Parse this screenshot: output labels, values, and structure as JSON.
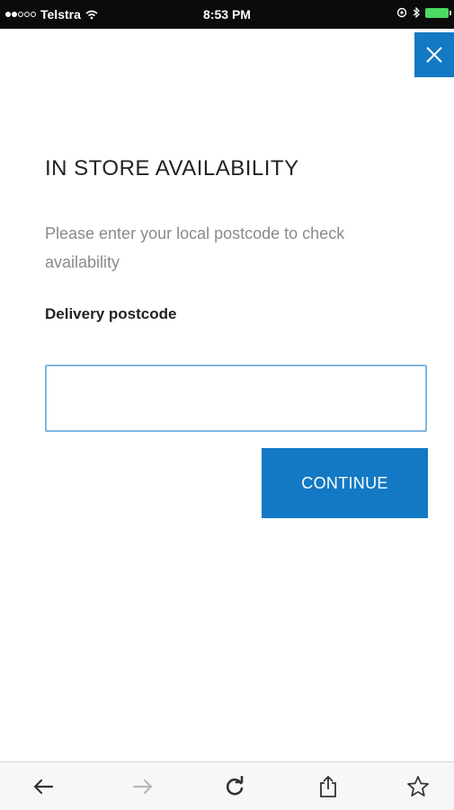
{
  "status_bar": {
    "carrier": "Telstra",
    "time": "8:53 PM",
    "signal_filled": 2,
    "signal_total": 5
  },
  "modal": {
    "close_icon": "close-icon",
    "title": "IN STORE AVAILABILITY",
    "intro": "Please enter your local postcode to check availability",
    "field_label": "Delivery postcode",
    "postcode_value": "",
    "continue_label": "CONTINUE"
  },
  "toolbar": {
    "icons": [
      "back-arrow-icon",
      "forward-arrow-icon",
      "reload-icon",
      "share-icon",
      "bookmark-star-icon"
    ]
  },
  "colors": {
    "accent": "#1479c4",
    "input_border": "#7fb6df",
    "muted_text": "#8a8a8a",
    "status_bar_bg": "#0b0b0b"
  }
}
